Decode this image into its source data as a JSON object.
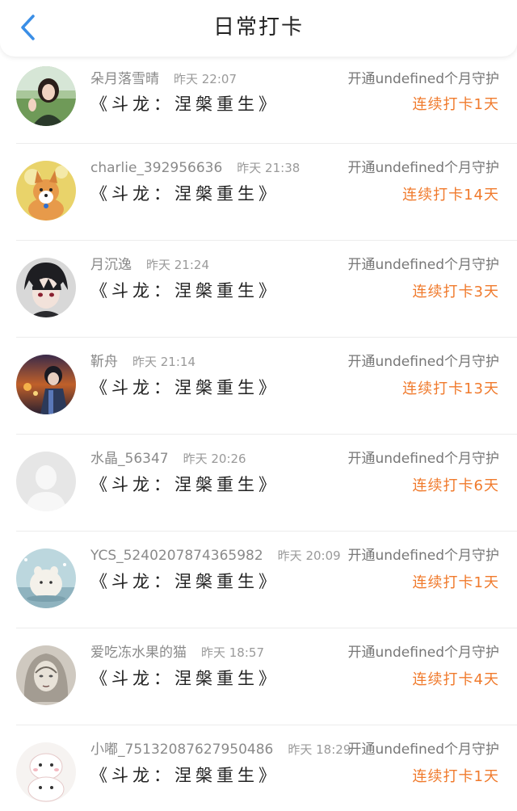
{
  "header": {
    "title": "日常打卡",
    "back_icon": "chevron-left-icon",
    "back_color": "#3a8ee6"
  },
  "colors": {
    "streak": "#f07a2c",
    "secondary_text": "#8a8a8a"
  },
  "items": [
    {
      "name": "朵月落雪晴",
      "time": "昨天 22:07",
      "book": "《斗龙：涅槃重生》",
      "guard": "开通undefined个月守护",
      "streak": "连续打卡1天",
      "avatar": "avatar-girl-icon"
    },
    {
      "name": "charlie_392956636",
      "time": "昨天 21:38",
      "book": "《斗龙：涅槃重生》",
      "guard": "开通undefined个月守护",
      "streak": "连续打卡14天",
      "avatar": "avatar-corgi-icon"
    },
    {
      "name": "月沉逸",
      "time": "昨天 21:24",
      "book": "《斗龙：涅槃重生》",
      "guard": "开通undefined个月守护",
      "streak": "连续打卡3天",
      "avatar": "avatar-anime-boy-icon"
    },
    {
      "name": "靳舟",
      "time": "昨天 21:14",
      "book": "《斗龙：涅槃重生》",
      "guard": "开通undefined个月守护",
      "streak": "连续打卡13天",
      "avatar": "avatar-anime-sunset-icon"
    },
    {
      "name": "水晶_56347",
      "time": "昨天 20:26",
      "book": "《斗龙：涅槃重生》",
      "guard": "开通undefined个月守护",
      "streak": "连续打卡6天",
      "avatar": "avatar-default-icon"
    },
    {
      "name": "YCS_5240207874365982",
      "time": "昨天 20:09",
      "book": "《斗龙：涅槃重生》",
      "guard": "开通undefined个月守护",
      "streak": "连续打卡1天",
      "avatar": "avatar-fluffy-icon"
    },
    {
      "name": "爱吃冻水果的猫",
      "time": "昨天 18:57",
      "book": "《斗龙：涅槃重生》",
      "guard": "开通undefined个月守护",
      "streak": "连续打卡4天",
      "avatar": "avatar-sketch-icon"
    },
    {
      "name": "小嘟_75132087627950486",
      "time": "昨天 18:29",
      "book": "《斗龙：涅槃重生》",
      "guard": "开通undefined个月守护",
      "streak": "连续打卡1天",
      "avatar": "avatar-puppy-icon"
    }
  ]
}
